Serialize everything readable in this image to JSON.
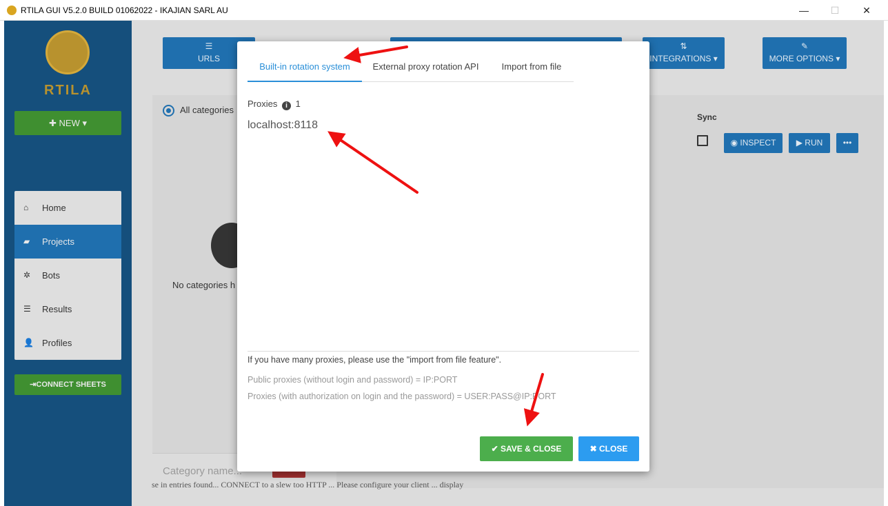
{
  "window": {
    "title": "RTILA GUI V5.2.0 BUILD 01062022 - IKAJIAN SARL AU",
    "minimize": "—",
    "maximize": "☐",
    "close": "✕"
  },
  "sidebar": {
    "logo_text": "RTILA",
    "new_label": "✚ NEW ▾",
    "items": [
      {
        "label": "Home",
        "icon": "home-icon",
        "glyph": "⌂"
      },
      {
        "label": "Projects",
        "icon": "folder-open-icon",
        "glyph": "▰"
      },
      {
        "label": "Bots",
        "icon": "gear-icon",
        "glyph": "✲"
      },
      {
        "label": "Results",
        "icon": "list-icon",
        "glyph": "☰"
      },
      {
        "label": "Profiles",
        "icon": "user-icon",
        "glyph": "👤"
      }
    ],
    "connect_sheets": "⇥CONNECT SHEETS"
  },
  "toolbar": {
    "urls_label": "URLS",
    "urls_icon": "☰",
    "integrations_label": "INTEGRATIONS ▾",
    "integrations_icon": "⇅",
    "more_label": "MORE OPTIONS ▾",
    "more_icon": "✎"
  },
  "left_panel": {
    "all_categories": "All categories",
    "no_categories": "No categories h",
    "category_placeholder": "Category name..."
  },
  "right_panel": {
    "sync": "Sync",
    "inspect": "◉ INSPECT",
    "run": "▶ RUN",
    "more": "•••"
  },
  "bottom_text": "se in entries found... CONNECT to a slew too HTTP ... Please configure your client ... display",
  "modal": {
    "tabs": [
      "Built-in rotation system",
      "External proxy rotation API",
      "Import from file"
    ],
    "active_tab": 0,
    "proxies_label": "Proxies",
    "proxies_count": "1",
    "proxies_value": "localhost:8118",
    "help1": "If you have many proxies, please use the \"import from file feature\".",
    "help2": "Public proxies (without login and password) = IP:PORT",
    "help3": "Proxies (with authorization on login and the password) = USER:PASS@IP:PORT",
    "save_close": "✔ SAVE & CLOSE",
    "close": "✖ CLOSE"
  },
  "colors": {
    "sidebar": "#154f7c",
    "accent": "#2a8fd8",
    "success": "#4cae4c",
    "annotation_arrow": "#ee1111"
  }
}
